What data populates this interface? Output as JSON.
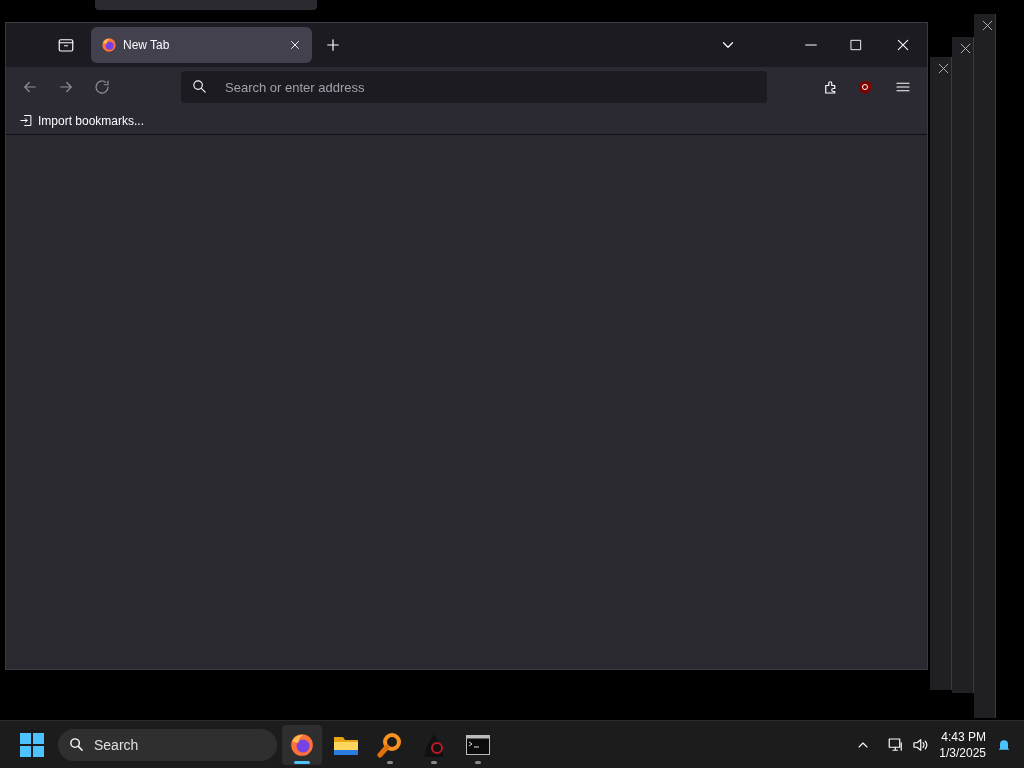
{
  "browser": {
    "tabs": [
      {
        "title": "New Tab",
        "selected": true
      }
    ],
    "address": {
      "placeholder": "Search or enter address"
    },
    "bookmarks": [
      {
        "label": "Import bookmarks..."
      }
    ]
  },
  "taskbar": {
    "search": {
      "placeholder": "Search"
    },
    "apps": [
      {
        "kind": "firefox",
        "selected": true,
        "running": true
      },
      {
        "kind": "folder",
        "selected": false,
        "running": false
      },
      {
        "kind": "magnifier",
        "selected": false,
        "running": true
      },
      {
        "kind": "hacker",
        "selected": false,
        "running": true
      },
      {
        "kind": "terminal",
        "selected": false,
        "running": true
      }
    ],
    "time": "4:43 PM",
    "date": "1/3/2025"
  }
}
